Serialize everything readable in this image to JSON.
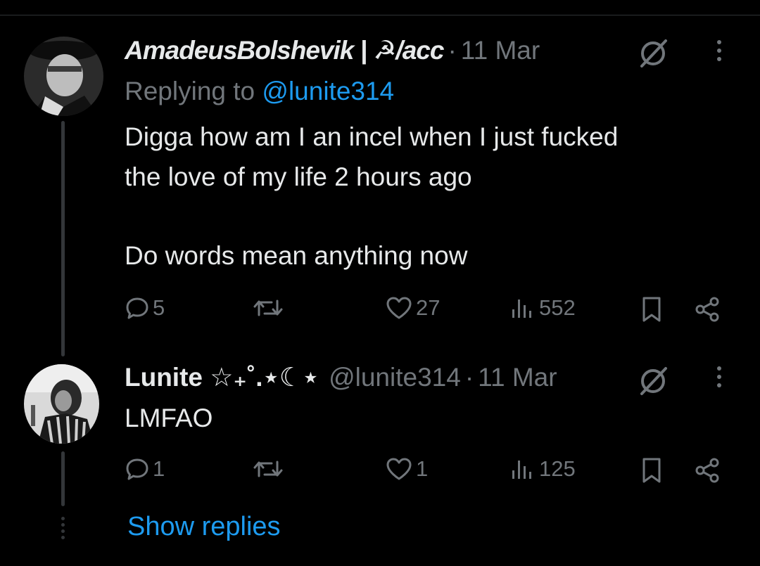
{
  "colors": {
    "background": "#000000",
    "text": "#e7e9ea",
    "muted": "#71767b",
    "link": "#1d9bf0",
    "divider": "#2f3336"
  },
  "tweets": [
    {
      "display_name": "AmadeusBolshevik | ☭/acc",
      "date": "11 Mar",
      "replying_to_label": "Replying to",
      "replying_to_handle": "@lunite314",
      "text_line1": "Digga how am I an incel when I just fucked",
      "text_line2": "the love of my life 2 hours ago",
      "text_para2": "Do words mean anything now",
      "actions": {
        "replies": "5",
        "likes": "27",
        "views": "552"
      },
      "icons": [
        "reply-icon",
        "retweet-icon",
        "like-icon",
        "views-icon",
        "bookmark-icon",
        "share-icon",
        "grok-icon",
        "more-icon"
      ]
    },
    {
      "display_name": "Lunite ☆₊˚.⋆☾⋆",
      "handle": "@lunite314",
      "date": "11 Mar",
      "text": "LMFAO",
      "actions": {
        "replies": "1",
        "likes": "1",
        "views": "125"
      },
      "icons": [
        "reply-icon",
        "retweet-icon",
        "like-icon",
        "views-icon",
        "bookmark-icon",
        "share-icon",
        "grok-icon",
        "more-icon"
      ]
    }
  ],
  "show_replies": "Show replies"
}
